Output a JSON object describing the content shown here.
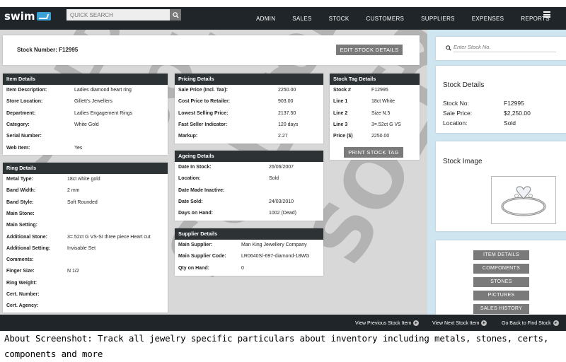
{
  "app": {
    "logo": "swim"
  },
  "search": {
    "placeholder": "QUICK SEARCH"
  },
  "nav": [
    "ADMIN",
    "SALES",
    "STOCK",
    "CUSTOMERS",
    "SUPPLIERS",
    "EXPENSES",
    "REPORTS"
  ],
  "watermark": "SOLD",
  "header": {
    "stock_number": "Stock Number: F12995",
    "edit_label": "EDIT STOCK DETAILS"
  },
  "item_details": {
    "title": "Item Details",
    "rows": [
      {
        "label": "Item Description:",
        "value": "Ladies diamond heart ring"
      },
      {
        "label": "Store Location:",
        "value": "Gillett's Jewellers"
      },
      {
        "label": "Department:",
        "value": "Ladies Engagement Rings"
      },
      {
        "label": "Category:",
        "value": "White Gold"
      },
      {
        "label": "Serial Number:",
        "value": ""
      },
      {
        "label": "Web Item:",
        "value": "Yes"
      }
    ]
  },
  "ring_details": {
    "title": "Ring Details",
    "rows": [
      {
        "label": "Metal Type:",
        "value": "18ct white gold"
      },
      {
        "label": "Band Width:",
        "value": "2 mm"
      },
      {
        "label": "Band Style:",
        "value": "Soft Rounded"
      },
      {
        "label": "Main Stone:",
        "value": ""
      },
      {
        "label": "Main Setting:",
        "value": ""
      },
      {
        "label": "Additional Stone:",
        "value": "3=.52ct G VS-SI three piece Heart cut"
      },
      {
        "label": "Additional Setting:",
        "value": "Invisable Set"
      },
      {
        "label": "Comments:",
        "value": ""
      },
      {
        "label": "Finger Size:",
        "value": "N 1/2"
      },
      {
        "label": "Ring Weight:",
        "value": ""
      },
      {
        "label": "Cert. Number:",
        "value": ""
      },
      {
        "label": "Cert. Agency:",
        "value": ""
      }
    ]
  },
  "pricing_details": {
    "title": "Pricing Details",
    "rows": [
      {
        "label": "Sale Price (Incl. Tax):",
        "value": "2250.00"
      },
      {
        "label": "Cost Price to Retailer:",
        "value": "903.00"
      },
      {
        "label": "Lowest Selling Price:",
        "value": "2137.50"
      },
      {
        "label": "Fast Seller Indicator:",
        "value": "120 days"
      },
      {
        "label": "Markup:",
        "value": "2.27"
      }
    ]
  },
  "ageing_details": {
    "title": "Ageing Details",
    "rows": [
      {
        "label": "Date In Stock:",
        "value": "26/06/2007"
      },
      {
        "label": "Location:",
        "value": "Sold"
      },
      {
        "label": "Date Made Inactive:",
        "value": ""
      },
      {
        "label": "Date Sold:",
        "value": "24/03/2010"
      },
      {
        "label": "Days on Hand:",
        "value": "1002 (Dead)"
      }
    ]
  },
  "supplier_details": {
    "title": "Supplier Details",
    "rows": [
      {
        "label": "Main Supplier:",
        "value": "Man King Jewellery Company"
      },
      {
        "label": "Main Supplier Code:",
        "value": "LR0640S/-697-diamond-18WG"
      },
      {
        "label": "Qty on Hand:",
        "value": "0"
      }
    ]
  },
  "stock_tag": {
    "title": "Stock Tag Details",
    "rows": [
      {
        "label": "Stock #",
        "value": "F12995"
      },
      {
        "label": "Line 1",
        "value": "18ct White"
      },
      {
        "label": "Line 2",
        "value": "Size N.5"
      },
      {
        "label": "Line 3",
        "value": "3=.52ct G VS"
      },
      {
        "label": "Price ($)",
        "value": "2250.00"
      }
    ],
    "print_label": "PRINT STOCK TAG"
  },
  "sidebar": {
    "search_placeholder": "Enter Stock No.",
    "stock_details_title": "Stock Details",
    "stock_details": [
      {
        "label": "Stock No:",
        "value": "F12995"
      },
      {
        "label": "Sale Price:",
        "value": "$2,250.00"
      },
      {
        "label": "Location:",
        "value": "Sold"
      }
    ],
    "image_title": "Stock Image",
    "buttons": [
      "ITEM DETAILS",
      "COMPONENTS",
      "STONES",
      "PICTURES",
      "SALES HISTORY"
    ]
  },
  "footer": {
    "prev": "View Previous Stock Item",
    "next": "View Next Stock Item",
    "back": "Go Back to Find Stock"
  },
  "caption": "About Screenshot: Track all jewelry specific particulars about inventory including metals, stones, certs, components and more"
}
